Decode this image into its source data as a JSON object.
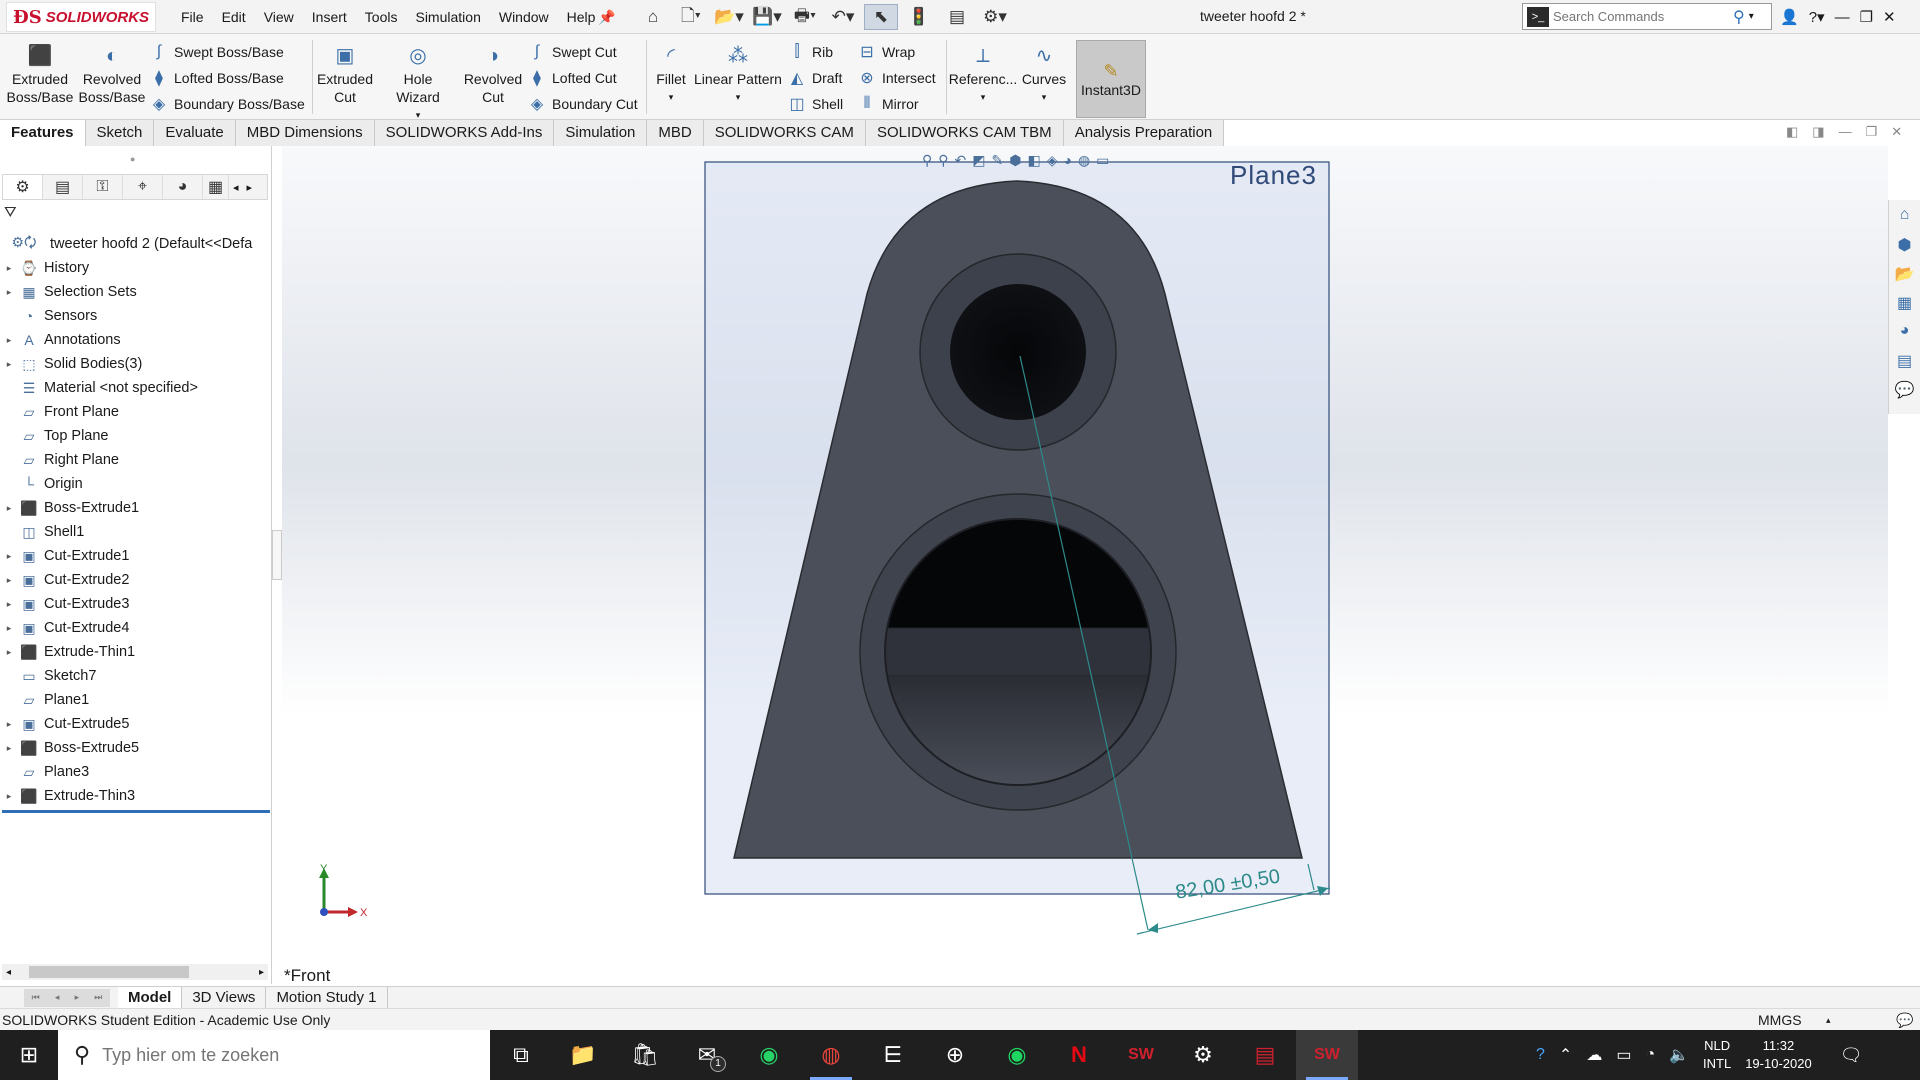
{
  "app": {
    "brand": "SOLIDWORKS",
    "document_title": "tweeter hoofd 2 *",
    "menu": [
      "File",
      "Edit",
      "View",
      "Insert",
      "Tools",
      "Simulation",
      "Window",
      "Help"
    ],
    "search_placeholder": "Search Commands"
  },
  "ribbon": {
    "extruded_boss": [
      "Extruded",
      "Boss/Base"
    ],
    "revolved_boss": [
      "Revolved",
      "Boss/Base"
    ],
    "swept_boss": "Swept Boss/Base",
    "lofted_boss": "Lofted Boss/Base",
    "boundary_boss": "Boundary Boss/Base",
    "extruded_cut": [
      "Extruded",
      "Cut"
    ],
    "hole_wizard": "Hole Wizard",
    "revolved_cut": [
      "Revolved",
      "Cut"
    ],
    "swept_cut": "Swept Cut",
    "lofted_cut": "Lofted Cut",
    "boundary_cut": "Boundary Cut",
    "fillet": "Fillet",
    "linear_pattern": "Linear Pattern",
    "rib": "Rib",
    "draft": "Draft",
    "shell": "Shell",
    "wrap": "Wrap",
    "intersect": "Intersect",
    "mirror": "Mirror",
    "reference": "Referenc...",
    "curves": "Curves",
    "instant3d": "Instant3D"
  },
  "tabs": [
    "Features",
    "Sketch",
    "Evaluate",
    "MBD Dimensions",
    "SOLIDWORKS Add-Ins",
    "Simulation",
    "MBD",
    "SOLIDWORKS CAM",
    "SOLIDWORKS CAM TBM",
    "Analysis Preparation"
  ],
  "feature_tree": {
    "root": "tweeter hoofd 2  (Default<<Defa",
    "items": [
      {
        "label": "History",
        "icon": "history-icon",
        "expand": true
      },
      {
        "label": "Selection Sets",
        "icon": "selection-sets-icon",
        "expand": true
      },
      {
        "label": "Sensors",
        "icon": "sensors-icon",
        "expand": false
      },
      {
        "label": "Annotations",
        "icon": "annotations-icon",
        "expand": true
      },
      {
        "label": "Solid Bodies(3)",
        "icon": "solid-bodies-icon",
        "expand": true
      },
      {
        "label": "Material <not specified>",
        "icon": "material-icon",
        "expand": false
      },
      {
        "label": "Front Plane",
        "icon": "plane-icon",
        "expand": false
      },
      {
        "label": "Top Plane",
        "icon": "plane-icon",
        "expand": false
      },
      {
        "label": "Right Plane",
        "icon": "plane-icon",
        "expand": false
      },
      {
        "label": "Origin",
        "icon": "origin-icon",
        "expand": false
      },
      {
        "label": "Boss-Extrude1",
        "icon": "extrude-icon",
        "expand": true
      },
      {
        "label": "Shell1",
        "icon": "shell-icon",
        "expand": false
      },
      {
        "label": "Cut-Extrude1",
        "icon": "cut-extrude-icon",
        "expand": true
      },
      {
        "label": "Cut-Extrude2",
        "icon": "cut-extrude-icon",
        "expand": true
      },
      {
        "label": "Cut-Extrude3",
        "icon": "cut-extrude-icon",
        "expand": true
      },
      {
        "label": "Cut-Extrude4",
        "icon": "cut-extrude-icon",
        "expand": true
      },
      {
        "label": "Extrude-Thin1",
        "icon": "extrude-icon",
        "expand": true
      },
      {
        "label": "Sketch7",
        "icon": "sketch-icon",
        "expand": false
      },
      {
        "label": "Plane1",
        "icon": "plane-icon",
        "expand": false
      },
      {
        "label": "Cut-Extrude5",
        "icon": "cut-extrude-icon",
        "expand": true
      },
      {
        "label": "Boss-Extrude5",
        "icon": "extrude-icon",
        "expand": true
      },
      {
        "label": "Plane3",
        "icon": "plane-icon",
        "expand": false
      },
      {
        "label": "Extrude-Thin3",
        "icon": "extrude-icon",
        "expand": true
      }
    ]
  },
  "graphics": {
    "plane_label": "Plane3",
    "view_name": "*Front",
    "dimension": "82,00 ±0,50",
    "triad_x": "X",
    "triad_y": "Y"
  },
  "bottom_tabs": [
    "Model",
    "3D Views",
    "Motion Study 1"
  ],
  "status": {
    "edition": "SOLIDWORKS Student Edition - Academic Use Only",
    "units": "MMGS"
  },
  "taskbar": {
    "search_placeholder": "Typ hier om te zoeken",
    "mail_badge": "1",
    "lang_line1": "NLD",
    "lang_line2": "INTL",
    "time": "11:32",
    "date": "19-10-2020"
  },
  "colors": {
    "brand_red": "#c8102e",
    "part_dark": "#4b4f5a",
    "selection_blue": "#2f6fb8",
    "dimension_teal": "#2d8a8a"
  }
}
